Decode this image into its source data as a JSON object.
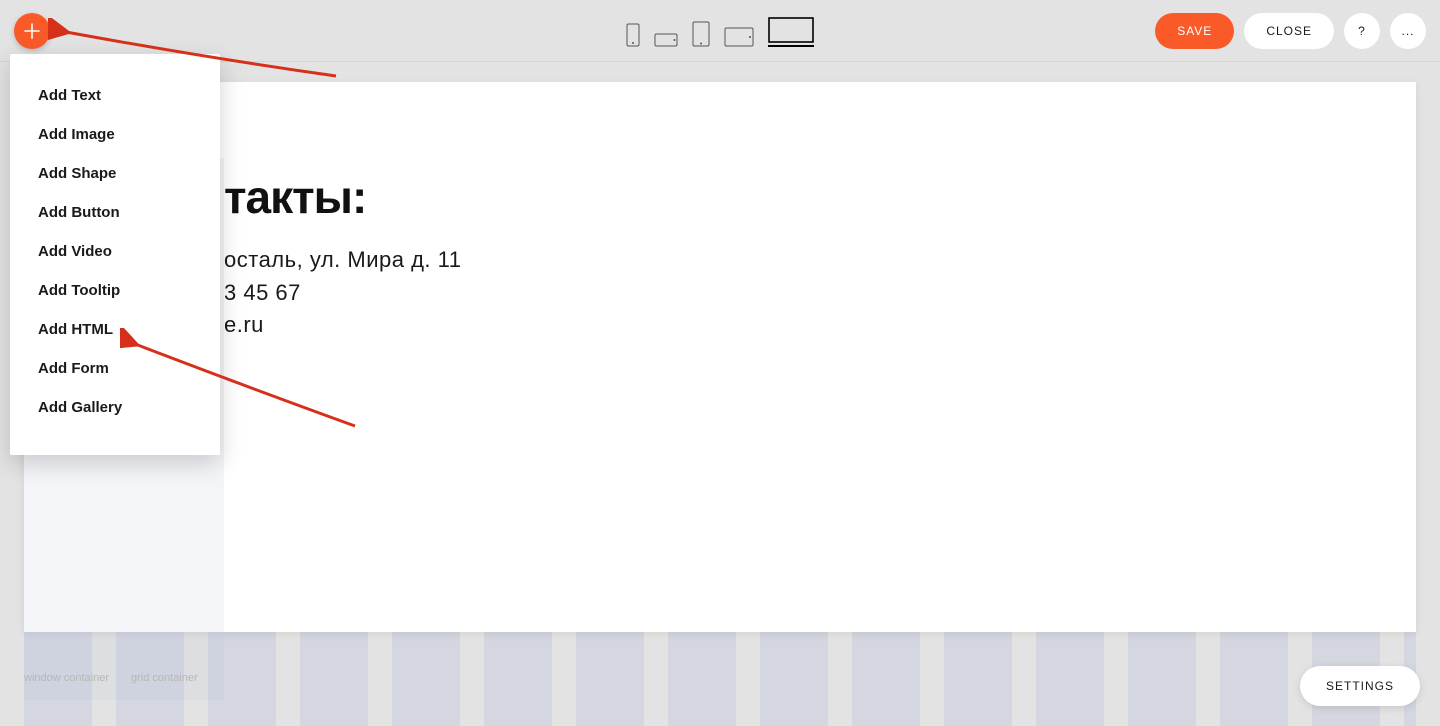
{
  "toolbar": {
    "save_label": "SAVE",
    "close_label": "CLOSE",
    "help_label": "?",
    "more_label": "..."
  },
  "devices": {
    "phone_portrait": "phone-portrait-icon",
    "phone_landscape": "phone-landscape-icon",
    "tablet_portrait": "tablet-portrait-icon",
    "tablet_landscape": "tablet-landscape-icon",
    "desktop": "desktop-icon"
  },
  "add_menu": {
    "items": [
      "Add Text",
      "Add Image",
      "Add Shape",
      "Add Button",
      "Add Video",
      "Add Tooltip",
      "Add HTML",
      "Add Form",
      "Add Gallery"
    ]
  },
  "page_content": {
    "title_fragment": "такты:",
    "line1_fragment": "осталь, ул. Мира д. 11",
    "line2_fragment": "3 45 67",
    "line3_fragment": "e.ru"
  },
  "footer": {
    "label1": "window container",
    "label2": "grid container"
  },
  "settings": {
    "label": "SETTINGS"
  },
  "colors": {
    "accent": "#fa5a28",
    "annotation": "#d6301a"
  }
}
